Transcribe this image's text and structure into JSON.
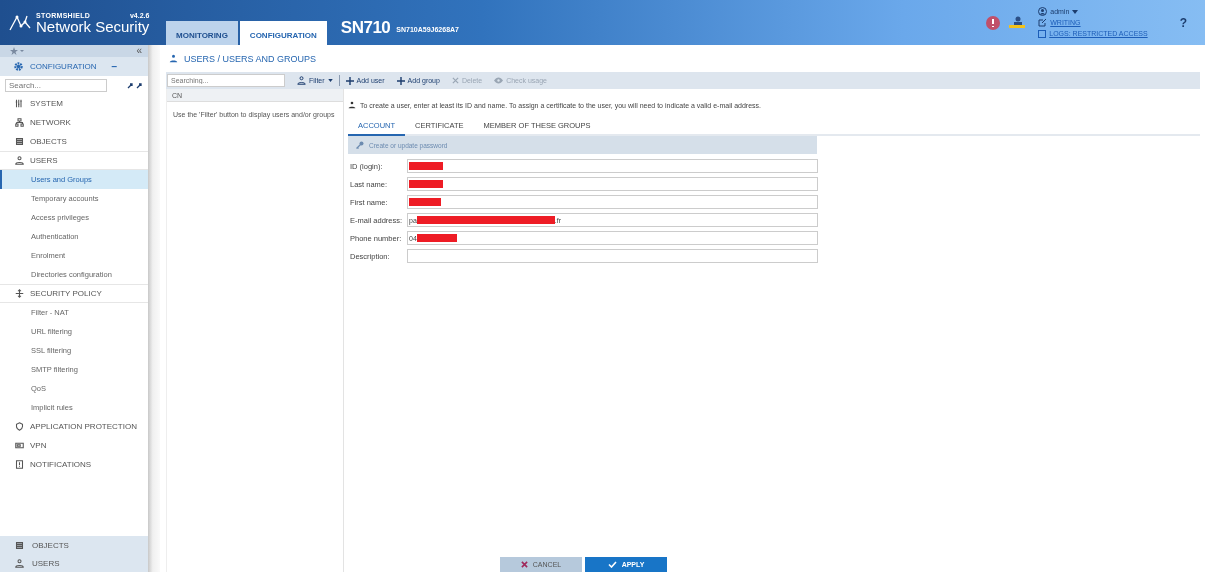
{
  "header": {
    "brand_small": "STORMSHIELD",
    "brand": "Network Security",
    "version": "v4.2.6",
    "tabs": [
      {
        "label": "MONITORING",
        "selected": false
      },
      {
        "label": "CONFIGURATION",
        "selected": true
      }
    ],
    "model": "SN710",
    "serial": "SN710A59J6268A7",
    "user": "admin",
    "mode_link": "WRITING",
    "logs_link": "LOGS: RESTRICTED ACCESS",
    "logs_checked": false,
    "help": "?"
  },
  "sidebar": {
    "collapse": "«",
    "section": "CONFIGURATION",
    "section_toggle": "−",
    "search_placeholder": "Search...",
    "items": [
      {
        "label": "SYSTEM",
        "expanded": false
      },
      {
        "label": "NETWORK",
        "expanded": false
      },
      {
        "label": "OBJECTS",
        "expanded": false
      },
      {
        "label": "USERS",
        "expanded": true,
        "children": [
          {
            "label": "Users and Groups",
            "selected": true
          },
          {
            "label": "Temporary accounts",
            "selected": false
          },
          {
            "label": "Access privileges",
            "selected": false
          },
          {
            "label": "Authentication",
            "selected": false
          },
          {
            "label": "Enrolment",
            "selected": false
          },
          {
            "label": "Directories configuration",
            "selected": false
          }
        ]
      },
      {
        "label": "SECURITY POLICY",
        "expanded": true,
        "children": [
          {
            "label": "Filter - NAT",
            "selected": false
          },
          {
            "label": "URL filtering",
            "selected": false
          },
          {
            "label": "SSL filtering",
            "selected": false
          },
          {
            "label": "SMTP filtering",
            "selected": false
          },
          {
            "label": "QoS",
            "selected": false
          },
          {
            "label": "Implicit rules",
            "selected": false
          }
        ]
      },
      {
        "label": "APPLICATION PROTECTION",
        "expanded": false
      },
      {
        "label": "VPN",
        "expanded": false
      },
      {
        "label": "NOTIFICATIONS",
        "expanded": false
      }
    ],
    "pinned": [
      {
        "label": "OBJECTS"
      },
      {
        "label": "USERS"
      }
    ]
  },
  "page": {
    "title": "USERS / USERS AND GROUPS",
    "search_placeholder": "Searching...",
    "toolbar": [
      {
        "kind": "filter",
        "label": "Filter",
        "disabled": false
      },
      {
        "kind": "add",
        "label": "Add user",
        "disabled": false
      },
      {
        "kind": "add",
        "label": "Add group",
        "disabled": false
      },
      {
        "kind": "delete",
        "label": "Delete",
        "disabled": true
      },
      {
        "kind": "view",
        "label": "Check usage",
        "disabled": true
      }
    ],
    "list_column": "CN",
    "list_hint": "Use the 'Filter' button to display users and/or groups",
    "info": "To create a user, enter at least its ID and name. To assign a certificate to the user, you will need to indicate a valid e-mail address.",
    "tabs": [
      {
        "label": "ACCOUNT",
        "selected": true
      },
      {
        "label": "CERTIFICATE",
        "selected": false
      },
      {
        "label": "MEMBER OF THESE GROUPS",
        "selected": false
      }
    ],
    "password_button": "Create or update password",
    "fields": [
      {
        "label": "ID (login):",
        "redacted": true
      },
      {
        "label": "Last name:",
        "redacted": true
      },
      {
        "label": "First name:",
        "redacted": true
      },
      {
        "label": "E-mail address:",
        "value_start": "pa",
        "redacted": true,
        "value_end": ".fr"
      },
      {
        "label": "Phone number:",
        "value_start": "04",
        "redacted": true
      },
      {
        "label": "Description:",
        "redacted": false
      }
    ],
    "cancel": "CANCEL",
    "apply": "APPLY"
  }
}
